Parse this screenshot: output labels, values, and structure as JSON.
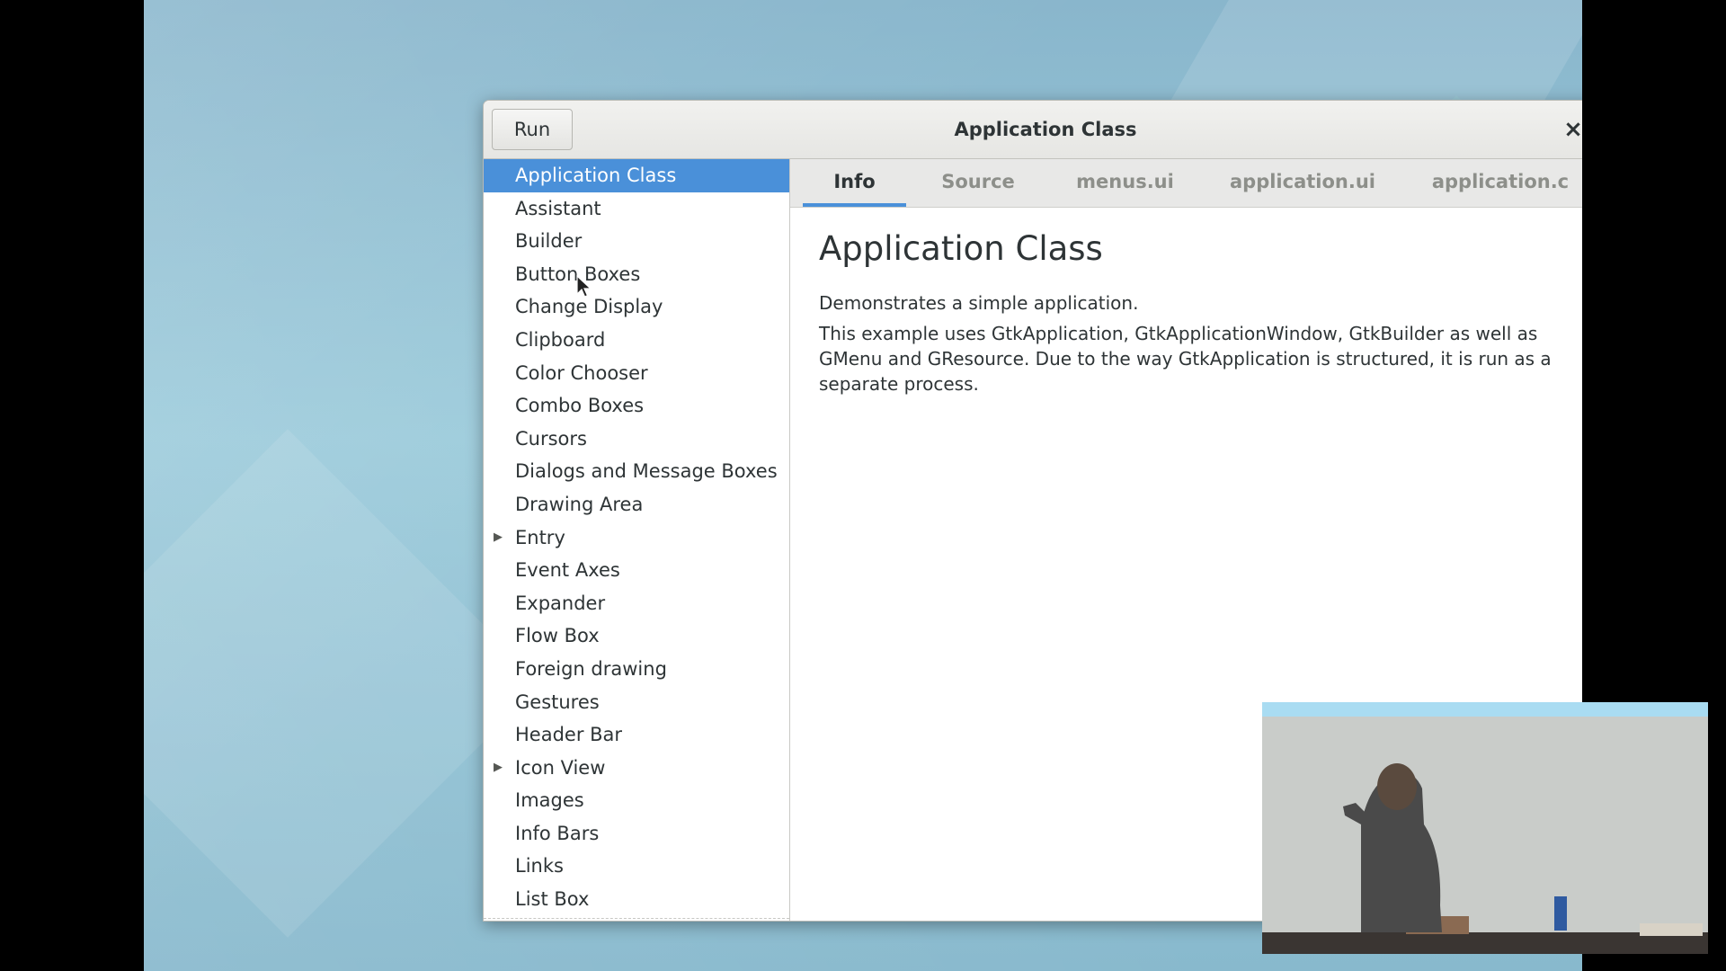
{
  "window": {
    "title": "Application Class",
    "run_label": "Run",
    "close_glyph": "×"
  },
  "sidebar": {
    "items": [
      {
        "label": "Application Class",
        "selected": true,
        "expandable": false
      },
      {
        "label": "Assistant",
        "selected": false,
        "expandable": false
      },
      {
        "label": "Builder",
        "selected": false,
        "expandable": false
      },
      {
        "label": "Button Boxes",
        "selected": false,
        "expandable": false
      },
      {
        "label": "Change Display",
        "selected": false,
        "expandable": false
      },
      {
        "label": "Clipboard",
        "selected": false,
        "expandable": false
      },
      {
        "label": "Color Chooser",
        "selected": false,
        "expandable": false
      },
      {
        "label": "Combo Boxes",
        "selected": false,
        "expandable": false
      },
      {
        "label": "Cursors",
        "selected": false,
        "expandable": false
      },
      {
        "label": "Dialogs and Message Boxes",
        "selected": false,
        "expandable": false
      },
      {
        "label": "Drawing Area",
        "selected": false,
        "expandable": false
      },
      {
        "label": "Entry",
        "selected": false,
        "expandable": true
      },
      {
        "label": "Event Axes",
        "selected": false,
        "expandable": false
      },
      {
        "label": "Expander",
        "selected": false,
        "expandable": false
      },
      {
        "label": "Flow Box",
        "selected": false,
        "expandable": false
      },
      {
        "label": "Foreign drawing",
        "selected": false,
        "expandable": false
      },
      {
        "label": "Gestures",
        "selected": false,
        "expandable": false
      },
      {
        "label": "Header Bar",
        "selected": false,
        "expandable": false
      },
      {
        "label": "Icon View",
        "selected": false,
        "expandable": true
      },
      {
        "label": "Images",
        "selected": false,
        "expandable": false
      },
      {
        "label": "Info Bars",
        "selected": false,
        "expandable": false
      },
      {
        "label": "Links",
        "selected": false,
        "expandable": false
      },
      {
        "label": "List Box",
        "selected": false,
        "expandable": false
      }
    ]
  },
  "tabs": [
    {
      "label": "Info",
      "active": true
    },
    {
      "label": "Source",
      "active": false
    },
    {
      "label": "menus.ui",
      "active": false
    },
    {
      "label": "application.ui",
      "active": false
    },
    {
      "label": "application.c",
      "active": false
    }
  ],
  "content": {
    "heading": "Application Class",
    "paragraphs": [
      "Demonstrates a simple application.",
      "This example uses GtkApplication, GtkApplicationWindow, GtkBuilder as well as GMenu and GResource. Due to the way GtkApplication is structured, it is run as a separate process."
    ]
  },
  "colors": {
    "selection": "#4a90d9",
    "text": "#2e3436",
    "inactive_tab_text": "#8d8f8a",
    "tab_bar_bg": "#e8e8e7"
  },
  "icons": {
    "expander": "triangle-right-icon",
    "close": "close-icon",
    "cursor": "mouse-pointer-icon"
  }
}
